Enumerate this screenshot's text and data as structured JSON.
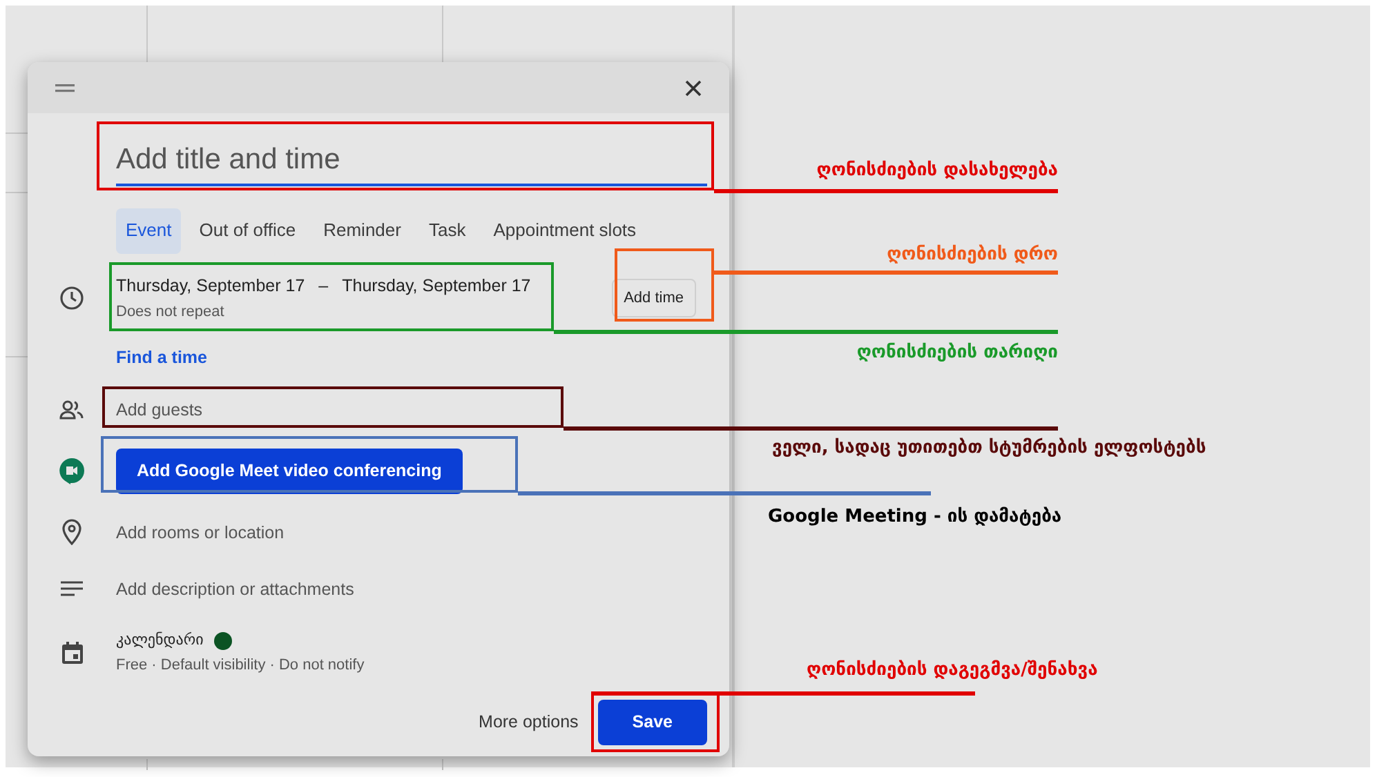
{
  "dialog": {
    "title_field": {
      "placeholder": "Add title and time"
    },
    "tabs": [
      {
        "label": "Event",
        "selected": true
      },
      {
        "label": "Out of office",
        "selected": false
      },
      {
        "label": "Reminder",
        "selected": false
      },
      {
        "label": "Task",
        "selected": false
      },
      {
        "label": "Appointment slots",
        "selected": false
      }
    ],
    "date": {
      "start": "Thursday, September 17",
      "separator": "–",
      "end": "Thursday, September 17",
      "repeat": "Does not repeat"
    },
    "add_time_button": "Add time",
    "find_time_link": "Find a time",
    "guests_field": {
      "placeholder": "Add guests"
    },
    "meet_button": "Add Google Meet video conferencing",
    "location": "Add rooms or location",
    "description": "Add description or attachments",
    "calendar": {
      "name": "კალენდარი",
      "color": "#0b5323",
      "details": "Free · Default visibility · Do not notify"
    },
    "more_options": "More options",
    "save_button": "Save"
  },
  "annotations": [
    {
      "text": "ღონისძიების დასახელება",
      "color": "#e00000"
    },
    {
      "text": "ღონისძიების დრო",
      "color": "#f05a1a"
    },
    {
      "text": "ღონისძიების თარიღი",
      "color": "#1a9a2a"
    },
    {
      "text": "ველი, სადაც უთითებთ სტუმრების ელფოსტებს",
      "color": "#5a0a0a"
    },
    {
      "text": "Google Meeting - ის დამატება",
      "color": "#4a72b8"
    },
    {
      "text": "ღონისძიების დაგეგმვა/შენახვა",
      "color": "#e00000"
    }
  ]
}
